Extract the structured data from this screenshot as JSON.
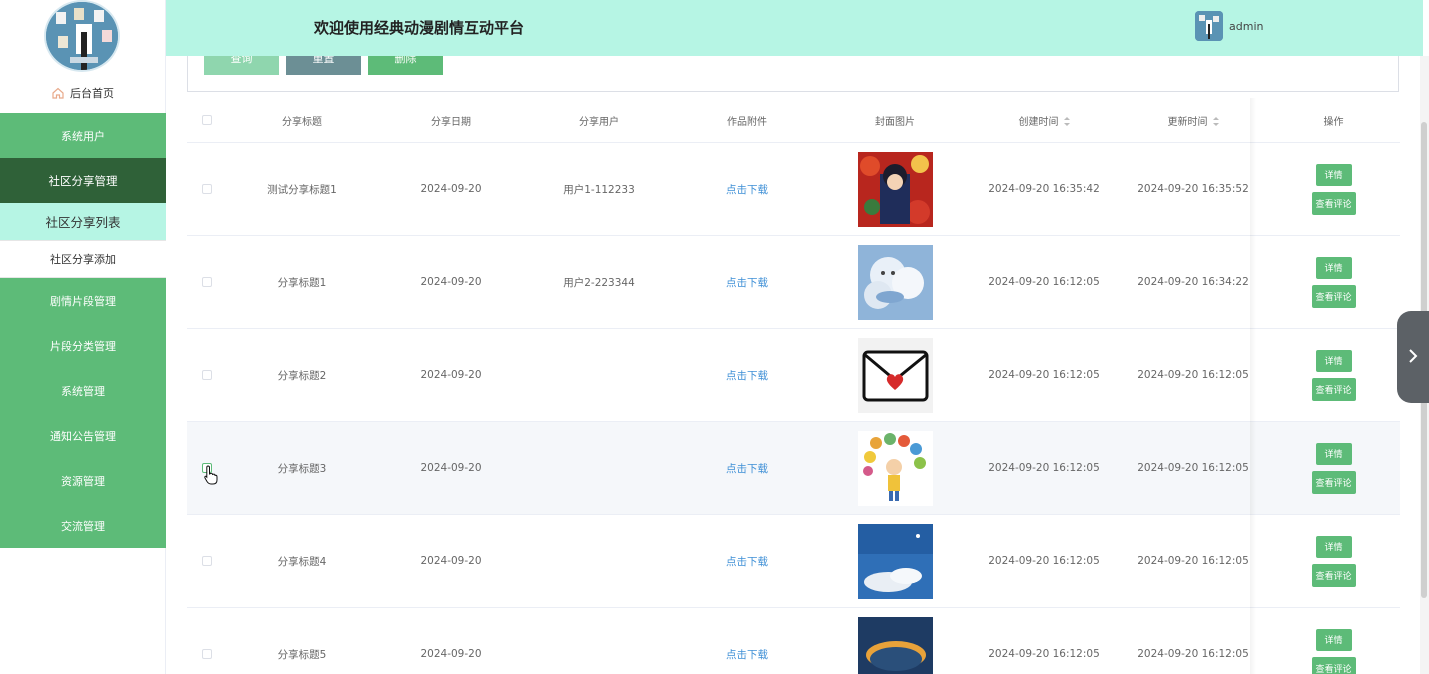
{
  "header": {
    "title": "欢迎使用经典动漫剧情互动平台",
    "username": "admin"
  },
  "sidebar": {
    "home_label": "后台首页",
    "items": [
      {
        "label": "系统用户",
        "active": false
      },
      {
        "label": "社区分享管理",
        "active": true
      }
    ],
    "submenu": [
      {
        "label": "社区分享列表",
        "current": true
      },
      {
        "label": "社区分享添加",
        "current": false
      }
    ],
    "items_after": [
      {
        "label": "剧情片段管理"
      },
      {
        "label": "片段分类管理"
      },
      {
        "label": "系统管理"
      },
      {
        "label": "通知公告管理"
      },
      {
        "label": "资源管理"
      },
      {
        "label": "交流管理"
      }
    ]
  },
  "toolbar": {
    "query_label": "查询",
    "reset_label": "重置",
    "delete_label": "删除"
  },
  "table": {
    "columns": [
      "分享标题",
      "分享日期",
      "分享用户",
      "作品附件",
      "封面图片",
      "创建时间",
      "更新时间",
      "操作"
    ],
    "detail_label": "详情",
    "comment_label": "查看评论",
    "rows": [
      {
        "title": "测试分享标题1",
        "date": "2024-09-20",
        "user": "用户1-112233",
        "attachment": "点击下载",
        "created": "2024-09-20 16:35:42",
        "updated": "2024-09-20 16:35:52",
        "cover": "anime-collage"
      },
      {
        "title": "分享标题1",
        "date": "2024-09-20",
        "user": "用户2-223344",
        "attachment": "点击下载",
        "created": "2024-09-20 16:12:05",
        "updated": "2024-09-20 16:34:22",
        "cover": "cloud-whale"
      },
      {
        "title": "分享标题2",
        "date": "2024-09-20",
        "user": "",
        "attachment": "点击下载",
        "created": "2024-09-20 16:12:05",
        "updated": "2024-09-20 16:12:05",
        "cover": "envelope-heart"
      },
      {
        "title": "分享标题3",
        "date": "2024-09-20",
        "user": "",
        "attachment": "点击下载",
        "created": "2024-09-20 16:12:05",
        "updated": "2024-09-20 16:12:05",
        "cover": "boy-balloons"
      },
      {
        "title": "分享标题4",
        "date": "2024-09-20",
        "user": "",
        "attachment": "点击下载",
        "created": "2024-09-20 16:12:05",
        "updated": "2024-09-20 16:12:05",
        "cover": "blue-sky"
      },
      {
        "title": "分享标题5",
        "date": "2024-09-20",
        "user": "",
        "attachment": "点击下载",
        "created": "2024-09-20 16:12:05",
        "updated": "2024-09-20 16:12:05",
        "cover": "sunset-sky"
      }
    ]
  },
  "colors": {
    "accent_green": "#5dbb78",
    "header_bg": "#b6f5e4",
    "active_menu": "#2f6138",
    "link": "#3e8fd6"
  }
}
